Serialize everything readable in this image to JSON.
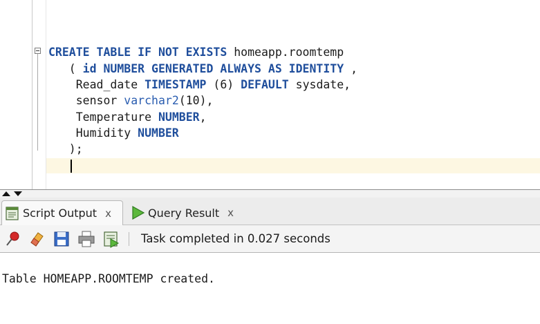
{
  "editor": {
    "lines": [
      {
        "kw1": "CREATE TABLE IF NOT EXISTS",
        "rest": " homeapp.roomtemp"
      },
      {
        "pre": "   ( ",
        "kw1": "id NUMBER GENERATED ALWAYS AS IDENTITY",
        "rest": " ,"
      },
      {
        "pre": "    Read_date ",
        "kw1": "TIMESTAMP",
        "rest": " (6) ",
        "kw2": "DEFAULT",
        "rest2": " sysdate,"
      },
      {
        "pre": "    sensor ",
        "ty1": "varchar2",
        "rest": "(10),"
      },
      {
        "pre": "    Temperature ",
        "kw1": "NUMBER",
        "rest": ","
      },
      {
        "pre": "    Humidity ",
        "kw1": "NUMBER"
      },
      {
        "pre": "   );"
      }
    ]
  },
  "tabs": {
    "script_output": {
      "label": "Script Output",
      "close": "x"
    },
    "query_result": {
      "label": "Query Result",
      "close": "x"
    }
  },
  "toolbar": {
    "status": "Task completed in 0.027 seconds"
  },
  "output": {
    "message": "Table HOMEAPP.ROOMTEMP created."
  },
  "icons": {
    "pin": "pin-icon",
    "eraser": "eraser-icon",
    "save": "save-icon",
    "print": "print-icon",
    "run_script": "run-script-icon"
  }
}
